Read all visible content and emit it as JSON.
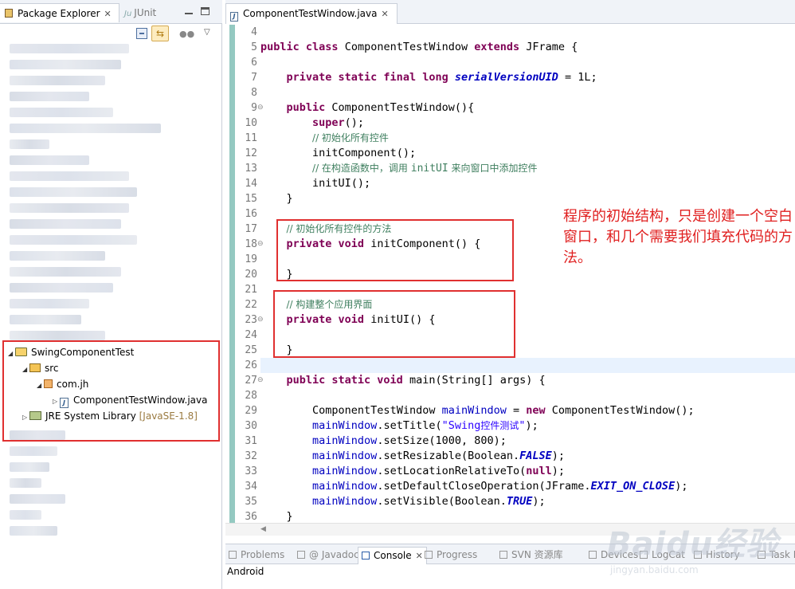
{
  "left_panel": {
    "tab_package_explorer": "Package Explorer",
    "tab_junit": "JUnit",
    "tree": {
      "project": "SwingComponentTest",
      "src": "src",
      "package": "com.jh",
      "file": "ComponentTestWindow.java",
      "library": "JRE System Library",
      "library_decor": "[JavaSE-1.8]"
    }
  },
  "editor": {
    "tab_title": "ComponentTestWindow.java",
    "line_numbers": [
      "4",
      "5",
      "6",
      "7",
      "8",
      "9",
      "10",
      "11",
      "12",
      "13",
      "14",
      "15",
      "16",
      "17",
      "18",
      "19",
      "20",
      "21",
      "22",
      "23",
      "24",
      "25",
      "26",
      "27",
      "28",
      "29",
      "30",
      "31",
      "32",
      "33",
      "34",
      "35",
      "36"
    ],
    "code": {
      "l5_kw1": "public",
      "l5_kw2": "class",
      "l5_name": " ComponentTestWindow ",
      "l5_kw3": "extends",
      "l5_rest": " JFrame {",
      "l7_kw": "private static final long",
      "l7_field": "serialVersionUID",
      "l7_rest": " = 1L;",
      "l9_kw": "public",
      "l9_rest": " ComponentTestWindow(){",
      "l10_kw": "super",
      "l10_rest": "();",
      "l11_cm": "// 初始化所有控件",
      "l12": "initComponent();",
      "l13_cm1": "// 在构造函数中，调用 ",
      "l13_cm2": "initUI",
      "l13_cm3": " 来向窗口中添加控件",
      "l14": "initUI();",
      "l15": "}",
      "l17_cm": "// 初始化所有控件的方法",
      "l18_kw": "private void",
      "l18_rest": " initComponent() {",
      "l20": "}",
      "l22_cm": "// 构建整个应用界面",
      "l23_kw": "private void",
      "l23_rest": " initUI() {",
      "l25": "}",
      "l27_kw": "public static void",
      "l27_rest": " main(String[] args) {",
      "l29_a": "ComponentTestWindow ",
      "l29_var": "mainWindow",
      "l29_b": " = ",
      "l29_kw": "new",
      "l29_c": " ComponentTestWindow();",
      "l30_var": "mainWindow",
      "l30_a": ".setTitle(",
      "l30_str1": "\"Swing",
      "l30_str2": "控件测试",
      "l30_str3": "\"",
      "l30_b": ");",
      "l31_var": "mainWindow",
      "l31_a": ".setSize(1000, 800);",
      "l32_var": "mainWindow",
      "l32_a": ".setResizable(Boolean.",
      "l32_const": "FALSE",
      "l32_b": ");",
      "l33_var": "mainWindow",
      "l33_a": ".setLocationRelativeTo(",
      "l33_kw": "null",
      "l33_b": ");",
      "l34_var": "mainWindow",
      "l34_a": ".setDefaultCloseOperation(JFrame.",
      "l34_const": "EXIT_ON_CLOSE",
      "l34_b": ");",
      "l35_var": "mainWindow",
      "l35_a": ".setVisible(Boolean.",
      "l35_const": "TRUE",
      "l35_b": ");",
      "l36": "}"
    },
    "annotation": "程序的初始结构，只是创建一个空白窗口，和几个需要我们填充代码的方法。"
  },
  "bottom_panel": {
    "tabs": [
      "Problems",
      "@ Javadoc",
      "Console",
      "Progress",
      "SVN 资源库",
      "Devices",
      "LogCat",
      "History",
      "Task Lis"
    ],
    "active_tab": "Console",
    "content": "Android"
  },
  "watermark": {
    "text": "Baidu经验",
    "sub": "jingyan.baidu.com"
  }
}
